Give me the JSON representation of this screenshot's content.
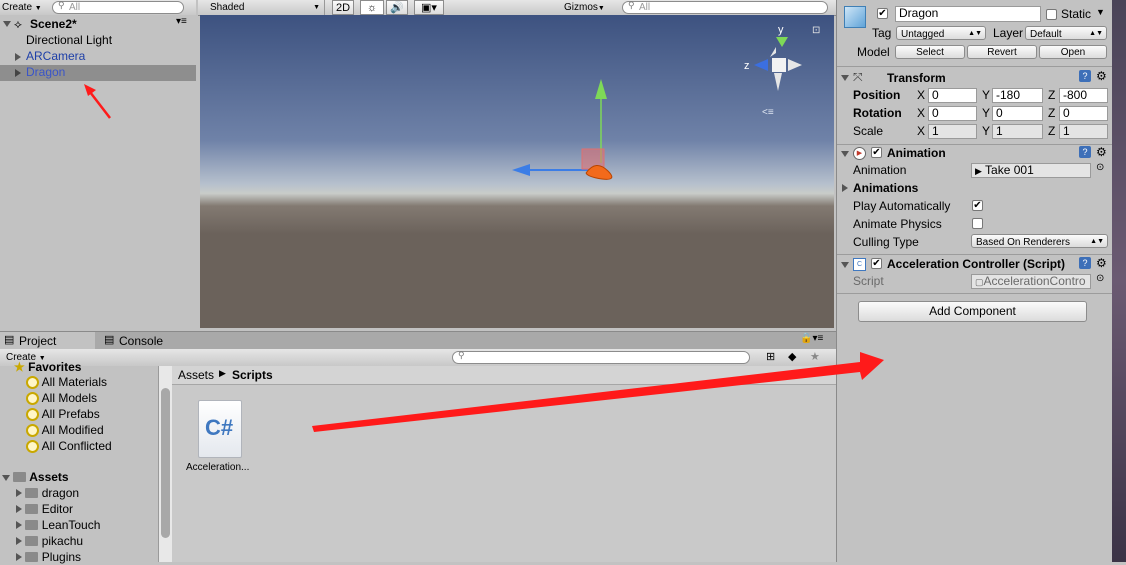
{
  "hierarchy": {
    "create_label": "Create",
    "search_placeholder": "All",
    "scene_name": "Scene2*",
    "items": [
      {
        "label": "Directional Light"
      },
      {
        "label": "ARCamera"
      },
      {
        "label": "Dragon"
      }
    ]
  },
  "scene_toolbar": {
    "shading": "Shaded",
    "mode_2d": "2D",
    "gizmos": "Gizmos",
    "search_placeholder": "All",
    "gizmo_axes": {
      "y": "y",
      "z": "z"
    }
  },
  "project": {
    "tab_project": "Project",
    "tab_console": "Console",
    "create_label": "Create",
    "favorites_label": "Favorites",
    "favorites": [
      "All Materials",
      "All Models",
      "All Prefabs",
      "All Modified",
      "All Conflicted"
    ],
    "assets_label": "Assets",
    "assets_folders": [
      "dragon",
      "Editor",
      "LeanTouch",
      "pikachu",
      "Plugins"
    ],
    "breadcrumb": {
      "root": "Assets",
      "current": "Scripts"
    },
    "files": [
      {
        "name": "Acceleration...",
        "icon_text": "C#"
      }
    ]
  },
  "inspector": {
    "object_name": "Dragon",
    "static_label": "Static",
    "tag_label": "Tag",
    "tag_value": "Untagged",
    "layer_label": "Layer",
    "layer_value": "Default",
    "model_label": "Model",
    "model_select": "Select",
    "model_revert": "Revert",
    "model_open": "Open",
    "transform": {
      "title": "Transform",
      "rows": [
        {
          "label": "Position",
          "x": "0",
          "y": "-180",
          "z": "-800"
        },
        {
          "label": "Rotation",
          "x": "0",
          "y": "0",
          "z": "0"
        },
        {
          "label": "Scale",
          "x": "1",
          "y": "1",
          "z": "1"
        }
      ],
      "axis_x": "X",
      "axis_y": "Y",
      "axis_z": "Z"
    },
    "animation": {
      "title": "Animation",
      "animation_label": "Animation",
      "animation_value": "Take 001",
      "animations_label": "Animations",
      "play_auto_label": "Play Automatically",
      "play_auto_checked": true,
      "animate_physics_label": "Animate Physics",
      "animate_physics_checked": false,
      "culling_label": "Culling Type",
      "culling_value": "Based On Renderers"
    },
    "script_component": {
      "title": "Acceleration Controller (Script)",
      "script_label": "Script",
      "script_value": "AccelerationContro"
    },
    "add_component": "Add Component"
  },
  "colors": {
    "selection": "#8e8e8e",
    "annotation_red": "#ff1a1a",
    "sky_top": "#3d5280",
    "ground": "#6b625b"
  }
}
